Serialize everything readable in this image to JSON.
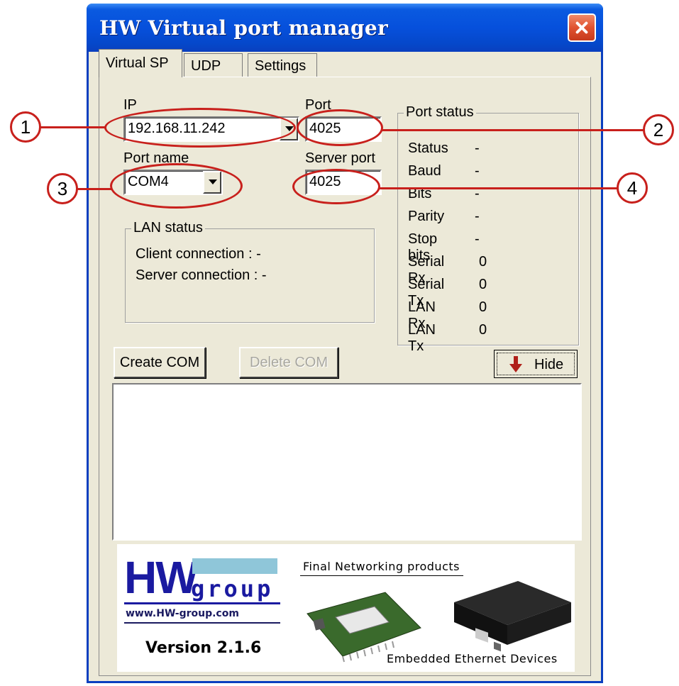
{
  "window": {
    "title": "HW Virtual port manager"
  },
  "tabs": [
    {
      "label": "Virtual SP"
    },
    {
      "label": "UDP"
    },
    {
      "label": "Settings"
    }
  ],
  "fields": {
    "ip_label": "IP",
    "ip_value": "192.168.11.242",
    "port_label": "Port",
    "port_value": "4025",
    "port_name_label": "Port name",
    "port_name_value": "COM4",
    "server_port_label": "Server port",
    "server_port_value": "4025"
  },
  "lan_status": {
    "title": "LAN status",
    "client": "Client connection  : -",
    "server": "Server connection : -"
  },
  "port_status": {
    "title": "Port status",
    "rows": [
      {
        "label": "Status",
        "value": "-"
      },
      {
        "label": "Baud",
        "value": "-"
      },
      {
        "label": "Bits",
        "value": "-"
      },
      {
        "label": "Parity",
        "value": "-"
      },
      {
        "label": "Stop bits",
        "value": "-"
      },
      {
        "label": "Serial Rx",
        "value": "0"
      },
      {
        "label": "Serial Tx",
        "value": "0"
      },
      {
        "label": "LAN Rx",
        "value": "0"
      },
      {
        "label": "LAN Tx",
        "value": "0"
      }
    ]
  },
  "buttons": {
    "create": "Create COM",
    "delete": "Delete COM",
    "hide": "Hide"
  },
  "banner": {
    "logo_hw": "HW",
    "logo_group": "group",
    "url": "www.HW-group.com",
    "version": "Version 2.1.6",
    "tagline": "Final Networking products",
    "footer": "Embedded Ethernet Devices"
  },
  "annotations": [
    "1",
    "2",
    "3",
    "4"
  ],
  "colors": {
    "annotation": "#c8201c",
    "titlebar": "#0650dc",
    "logo": "#1a1aa0",
    "logo_bar": "#8fc6d9"
  }
}
